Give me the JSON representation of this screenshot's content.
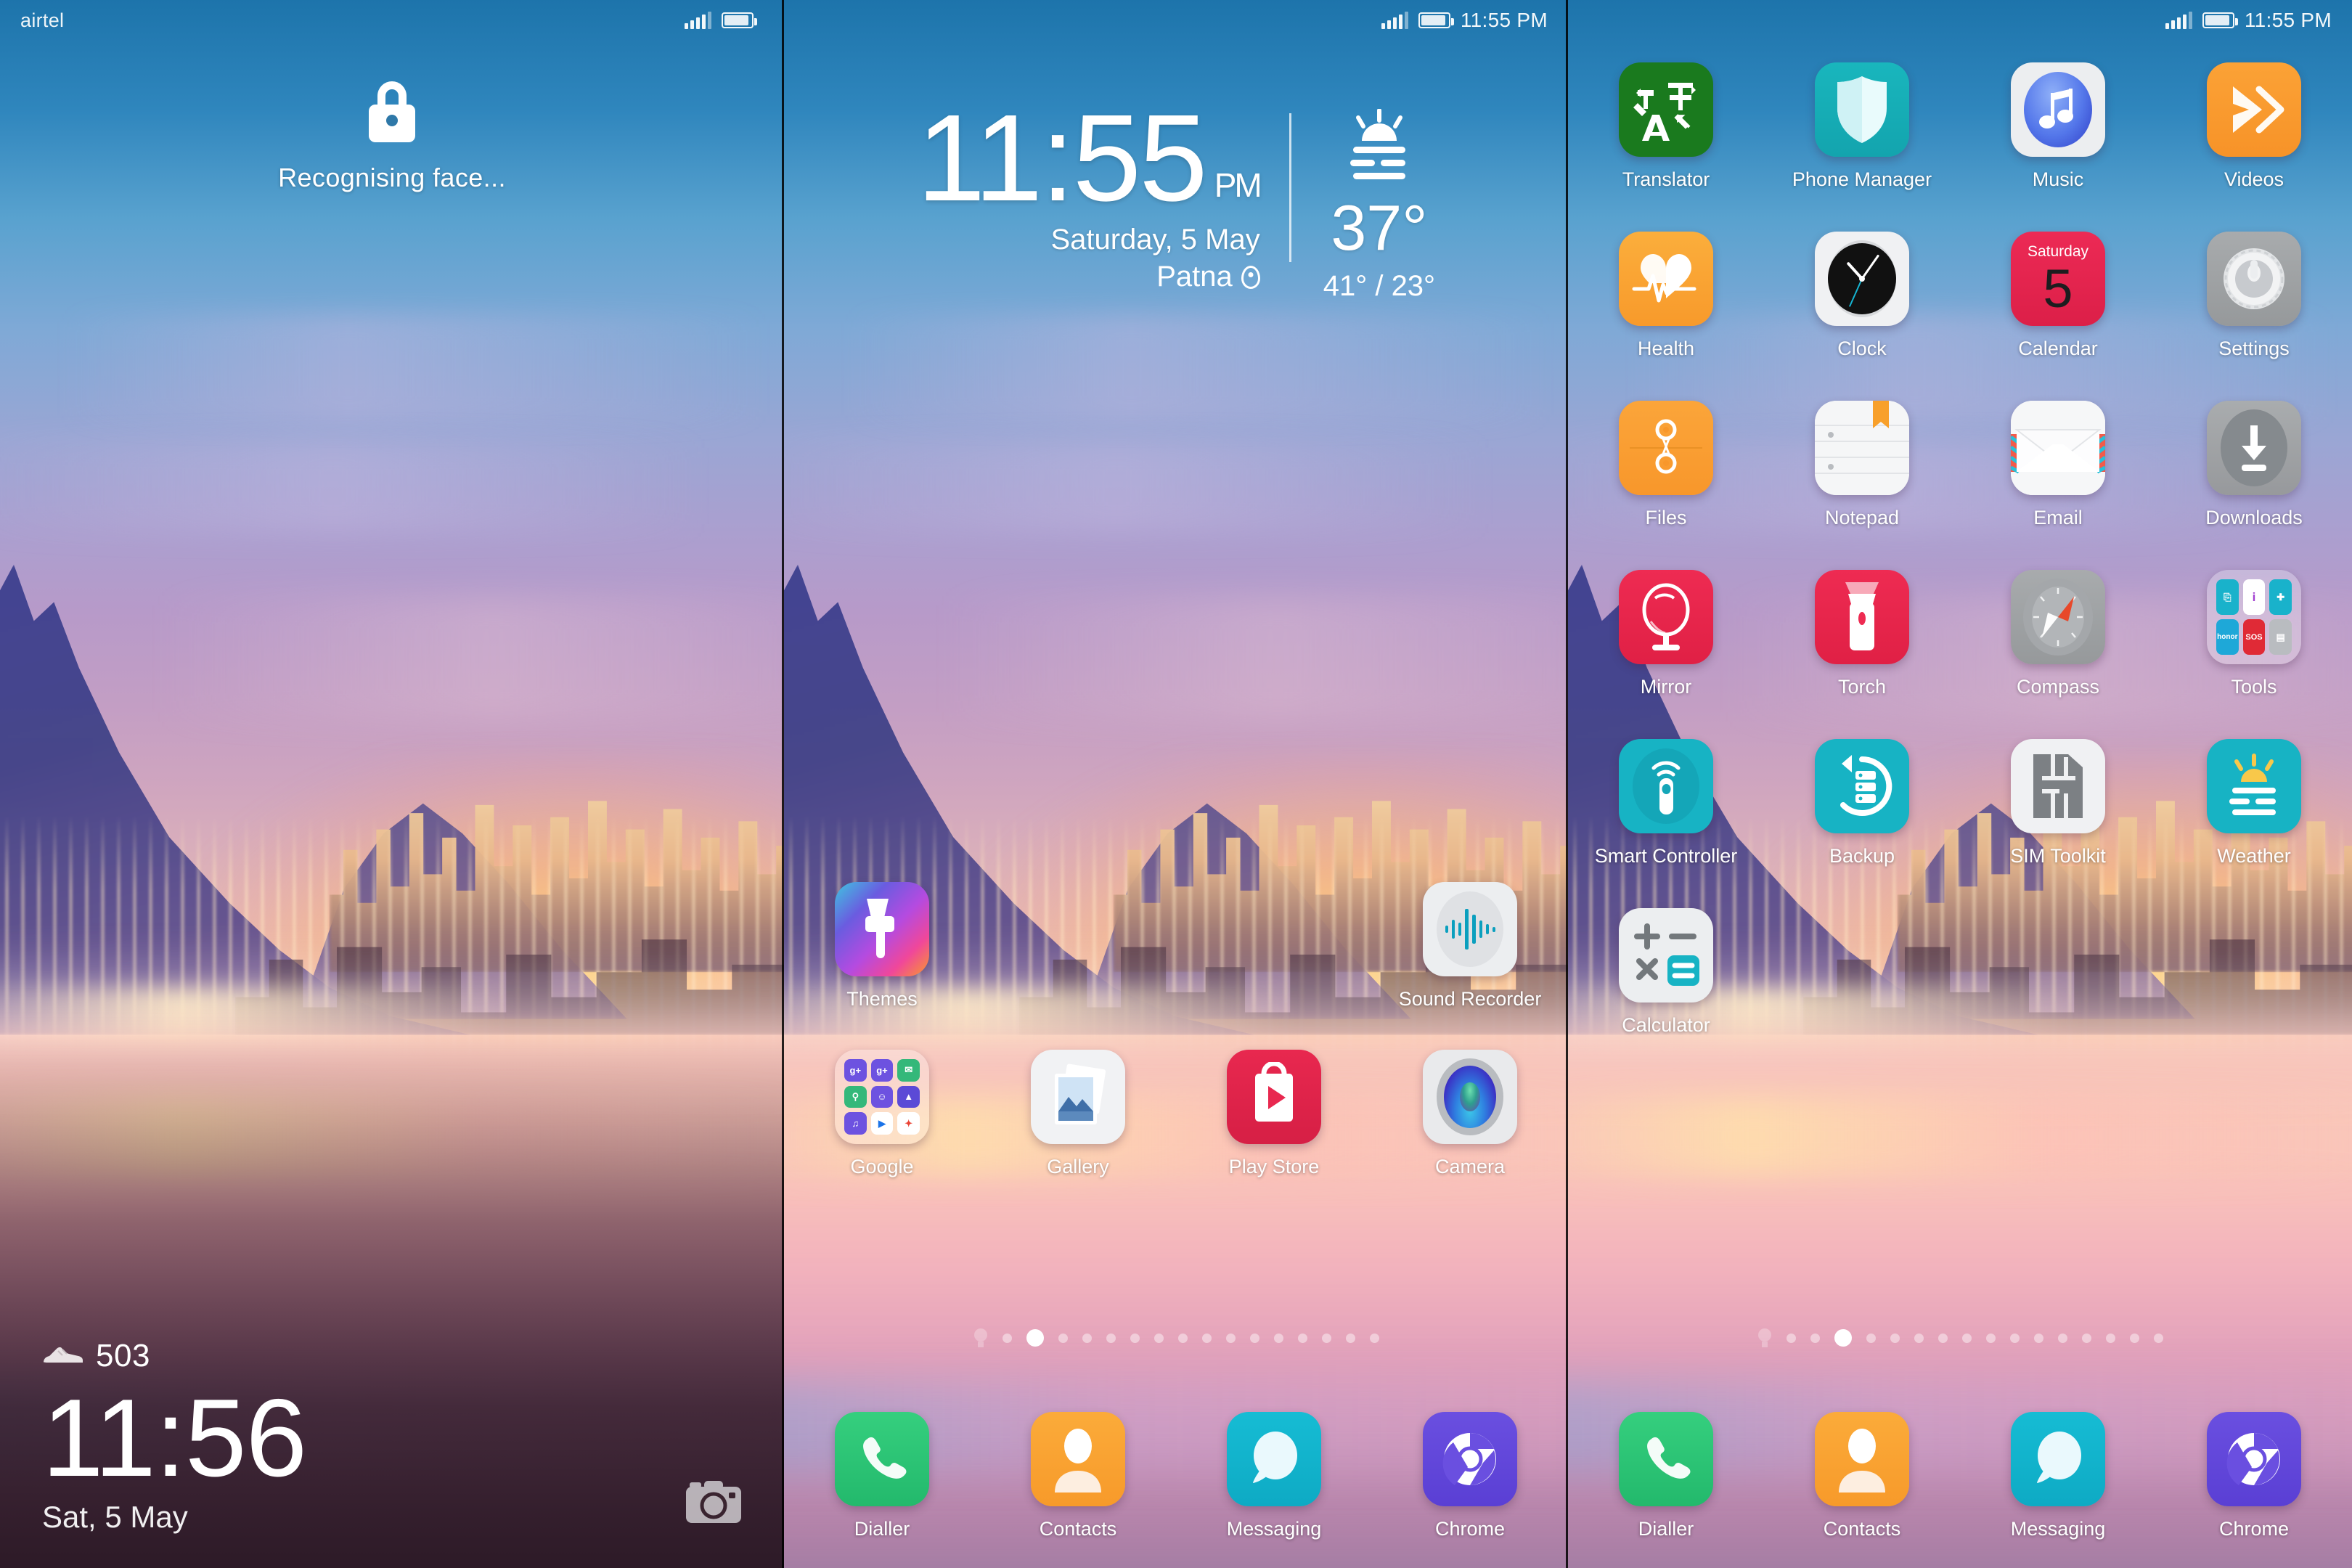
{
  "panels": [
    {
      "type": "lockscreen",
      "statusbar": {
        "carrier": "airtel",
        "time": "",
        "signal_icon": "signal-bars-icon",
        "battery_icon": "battery-icon"
      },
      "lock_icon": "lock-icon",
      "lock_message": "Recognising face...",
      "steps_icon": "shoe-icon",
      "steps_count": "503",
      "time": "11:56",
      "date": "Sat, 5 May",
      "camera_shortcut_icon": "camera-icon"
    },
    {
      "type": "homescreen",
      "statusbar": {
        "carrier": "",
        "time": "11:55 PM",
        "signal_icon": "signal-bars-icon",
        "battery_icon": "battery-icon"
      },
      "widget": {
        "time": "11:55",
        "ampm": "PM",
        "date": "Saturday, 5 May",
        "location": "Patna",
        "location_icon": "map-pin-icon",
        "weather_icon": "haze-sunrise-icon",
        "temperature": "37°",
        "range": "41° / 23°"
      },
      "rows": [
        [
          {
            "label": "Themes",
            "icon": "themes-icon",
            "cls": "i-themes"
          },
          {
            "label": "",
            "icon": "",
            "cls": "",
            "empty": true
          },
          {
            "label": "",
            "icon": "",
            "cls": "",
            "empty": true
          },
          {
            "label": "Sound Recorder",
            "icon": "sound-recorder-icon",
            "cls": "i-recorder"
          }
        ],
        [
          {
            "label": "Google",
            "icon": "google-folder-icon",
            "cls": "i-folder"
          },
          {
            "label": "Gallery",
            "icon": "gallery-icon",
            "cls": "i-gallery"
          },
          {
            "label": "Play Store",
            "icon": "play-store-icon",
            "cls": "i-playstore"
          },
          {
            "label": "Camera",
            "icon": "camera-icon",
            "cls": "i-camera"
          }
        ]
      ],
      "dock": [
        {
          "label": "Dialler",
          "icon": "phone-icon",
          "cls": "i-dialler"
        },
        {
          "label": "Contacts",
          "icon": "contacts-icon",
          "cls": "i-contacts"
        },
        {
          "label": "Messaging",
          "icon": "message-bubble-icon",
          "cls": "i-messaging"
        },
        {
          "label": "Chrome",
          "icon": "chrome-icon",
          "cls": "i-chrome"
        }
      ],
      "page_indicator": {
        "total": 16,
        "active_index": 1,
        "leading_icon": "bulb-icon"
      }
    },
    {
      "type": "homescreen",
      "statusbar": {
        "carrier": "",
        "time": "11:55 PM",
        "signal_icon": "signal-bars-icon",
        "battery_icon": "battery-icon"
      },
      "rows": [
        [
          {
            "label": "Translator",
            "icon": "translator-icon",
            "cls": "i-translator"
          },
          {
            "label": "Phone Manager",
            "icon": "shield-icon",
            "cls": "i-phonemanager"
          },
          {
            "label": "Music",
            "icon": "music-note-icon",
            "cls": "i-music"
          },
          {
            "label": "Videos",
            "icon": "video-play-icon",
            "cls": "i-videos"
          }
        ],
        [
          {
            "label": "Health",
            "icon": "heart-pulse-icon",
            "cls": "i-health"
          },
          {
            "label": "Clock",
            "icon": "analog-clock-icon",
            "cls": "i-clock"
          },
          {
            "label": "Calendar",
            "icon": "calendar-icon",
            "cls": "i-calendar",
            "day": "Saturday",
            "date": "5"
          },
          {
            "label": "Settings",
            "icon": "gear-icon",
            "cls": "i-settings"
          }
        ],
        [
          {
            "label": "Files",
            "icon": "files-icon",
            "cls": "i-files"
          },
          {
            "label": "Notepad",
            "icon": "notepad-icon",
            "cls": "i-notepad"
          },
          {
            "label": "Email",
            "icon": "envelope-icon",
            "cls": "i-email"
          },
          {
            "label": "Downloads",
            "icon": "download-arrow-icon",
            "cls": "i-downloads"
          }
        ],
        [
          {
            "label": "Mirror",
            "icon": "mirror-icon",
            "cls": "i-mirror"
          },
          {
            "label": "Torch",
            "icon": "flashlight-icon",
            "cls": "i-torch"
          },
          {
            "label": "Compass",
            "icon": "compass-icon",
            "cls": "i-compass"
          },
          {
            "label": "Tools",
            "icon": "tools-folder-icon",
            "cls": "i-folder",
            "folder": [
              "phone-clone",
              "i",
              "puzzle",
              "honor",
              "SOS",
              "sim"
            ]
          }
        ],
        [
          {
            "label": "Smart Controller",
            "icon": "remote-control-icon",
            "cls": "i-smartctl"
          },
          {
            "label": "Backup",
            "icon": "backup-icon",
            "cls": "i-backup"
          },
          {
            "label": "SIM Toolkit",
            "icon": "sim-card-icon",
            "cls": "i-simtk"
          },
          {
            "label": "Weather",
            "icon": "haze-sunrise-icon",
            "cls": "i-weather"
          }
        ],
        [
          {
            "label": "Calculator",
            "icon": "calculator-icon",
            "cls": "i-calc"
          },
          {
            "label": "",
            "icon": "",
            "cls": "",
            "empty": true
          },
          {
            "label": "",
            "icon": "",
            "cls": "",
            "empty": true
          },
          {
            "label": "",
            "icon": "",
            "cls": "",
            "empty": true
          }
        ]
      ],
      "dock": [
        {
          "label": "Dialler",
          "icon": "phone-icon",
          "cls": "i-dialler"
        },
        {
          "label": "Contacts",
          "icon": "contacts-icon",
          "cls": "i-contacts"
        },
        {
          "label": "Messaging",
          "icon": "message-bubble-icon",
          "cls": "i-messaging"
        },
        {
          "label": "Chrome",
          "icon": "chrome-icon",
          "cls": "i-chrome"
        }
      ],
      "page_indicator": {
        "total": 16,
        "active_index": 2,
        "leading_icon": "bulb-icon"
      }
    }
  ],
  "colors": {
    "accent_teal": "#17b3c4",
    "accent_red": "#ec2a55",
    "accent_orange": "#fba53a",
    "accent_green": "#1a7a1e",
    "dock_blue": "#5a3fd4"
  }
}
